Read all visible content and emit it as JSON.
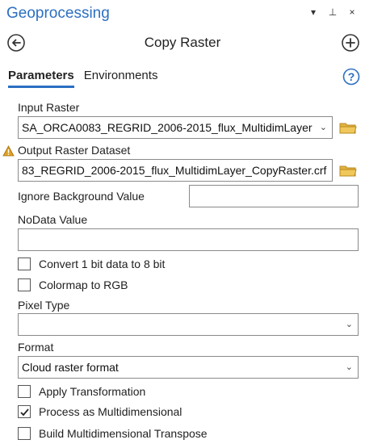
{
  "pane": {
    "title": "Geoprocessing",
    "ctrl_dropdown": "▾",
    "ctrl_pin": "⊥",
    "ctrl_close": "×"
  },
  "tool": {
    "title": "Copy Raster"
  },
  "tabs": [
    {
      "label": "Parameters",
      "active": true
    },
    {
      "label": "Environments",
      "active": false
    }
  ],
  "params": {
    "input_raster": {
      "label": "Input Raster",
      "value": "SA_ORCA0083_REGRID_2006-2015_flux_MultidimLayer"
    },
    "output_raster": {
      "label": "Output Raster Dataset",
      "value": "83_REGRID_2006-2015_flux_MultidimLayer_CopyRaster.crf"
    },
    "ignore_background": {
      "label": "Ignore Background Value",
      "value": ""
    },
    "nodata": {
      "label": "NoData Value",
      "value": ""
    },
    "convert_1bit": {
      "label": "Convert 1 bit data to 8 bit",
      "checked": false
    },
    "colormap_rgb": {
      "label": "Colormap to RGB",
      "checked": false
    },
    "pixel_type": {
      "label": "Pixel Type",
      "value": ""
    },
    "format": {
      "label": "Format",
      "value": "Cloud raster format"
    },
    "apply_transformation": {
      "label": "Apply Transformation",
      "checked": false
    },
    "process_multidim": {
      "label": "Process as Multidimensional",
      "checked": true
    },
    "build_transpose": {
      "label": "Build Multidimensional Transpose",
      "checked": false
    }
  },
  "colors": {
    "accent": "#2b6fc2",
    "folder": "#e3b341",
    "warning": "#e0a020"
  }
}
